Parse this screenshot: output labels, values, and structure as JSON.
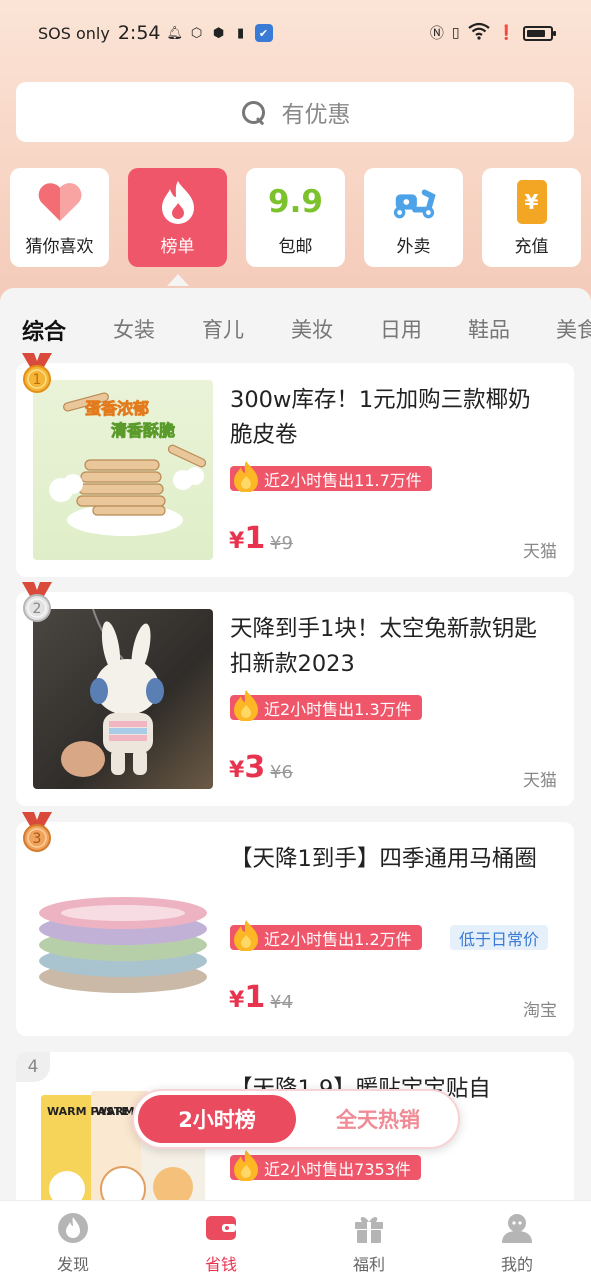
{
  "status_bar": {
    "carrier": "SOS only",
    "time": "2:54"
  },
  "search": {
    "placeholder": "有优惠"
  },
  "quick_nav": [
    {
      "label": "猜你喜欢",
      "icon": "heart-icon"
    },
    {
      "label": "榜单",
      "icon": "flame-icon",
      "active": true
    },
    {
      "label": "包邮",
      "icon": "nine-nine-icon",
      "icon_text": "9.9"
    },
    {
      "label": "外卖",
      "icon": "scooter-icon"
    },
    {
      "label": "充值",
      "icon": "phone-recharge-icon",
      "icon_text": "¥"
    }
  ],
  "categories": [
    "综合",
    "女装",
    "育儿",
    "美妆",
    "日用",
    "鞋品",
    "美食"
  ],
  "active_category": "综合",
  "products": [
    {
      "rank": "1",
      "title": "300w库存！1元加购三款椰奶脆皮卷",
      "sales": "近2小时售出11.7万件",
      "price_symbol": "¥",
      "price": "1",
      "original_price": "¥9",
      "shop": "天猫",
      "image_text": [
        "蛋香浓郁",
        "清香酥脆"
      ]
    },
    {
      "rank": "2",
      "title": "天降到手1块！太空兔新款钥匙扣新款2023",
      "sales": "近2小时售出1.3万件",
      "price_symbol": "¥",
      "price": "3",
      "original_price": "¥6",
      "shop": "天猫"
    },
    {
      "rank": "3",
      "title": "【天降1到手】四季通用马桶圈",
      "sales": "近2小时售出1.2万件",
      "extra_tag": "低于日常价",
      "price_symbol": "¥",
      "price": "1",
      "original_price": "¥4",
      "shop": "淘宝"
    },
    {
      "rank": "4",
      "title": "【天降1.9】暖贴宝宝贴自",
      "sales": "近2小时售出7353件",
      "image_text": [
        "WARM PASTE",
        "WARM PASTE"
      ]
    }
  ],
  "float_toggle": {
    "active": "2小时榜",
    "inactive": "全天热销"
  },
  "bottom_nav": [
    {
      "label": "发现",
      "icon": "discover-flame-icon"
    },
    {
      "label": "省钱",
      "icon": "wallet-icon",
      "active": true
    },
    {
      "label": "福利",
      "icon": "gift-icon"
    },
    {
      "label": "我的",
      "icon": "profile-icon"
    }
  ],
  "colors": {
    "accent": "#f0566a",
    "price": "#e8334f",
    "header_bg": "#f7d3c2"
  }
}
